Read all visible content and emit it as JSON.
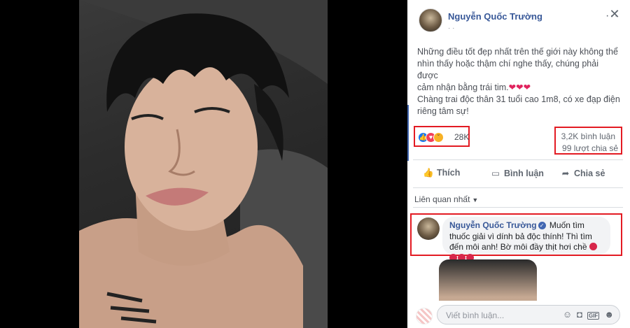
{
  "post": {
    "author": "Nguyễn Quốc Trường",
    "subtitle": "· ·",
    "more_label": "···",
    "close_label": "✕",
    "text_lines": [
      "Những điều tốt đẹp nhất trên thế giới này không thể",
      "nhìn thấy hoặc thậm chí nghe thấy, chúng phải được",
      "cảm nhận bằng trái tim.",
      "Chàng trai độc thân 31 tuổi cao 1m8, có xe đạp điện",
      "riêng tâm sự!"
    ],
    "hearts": "❤❤❤"
  },
  "stats": {
    "reactions_count": "28K",
    "reaction_icons": [
      "like-icon",
      "love-icon",
      "haha-icon"
    ],
    "comments": "3,2K bình luận",
    "shares": "99 lượt chia sẻ"
  },
  "actions": {
    "like": "Thích",
    "comment": "Bình luận",
    "share": "Chia sẻ"
  },
  "comments_section": {
    "sort_label": "Liên quan nhất",
    "top_comment": {
      "author": "Nguyễn Quốc Trường",
      "text_part1": "Muốn tìm thuốc giải vì dính bả độc thính! Thì tìm đến môi anh! Bờ môi đầy thịt hơi chề"
    },
    "write_placeholder": "Viết bình luận..."
  },
  "colors": {
    "brand_blue": "#385898",
    "highlight_red": "#e31b23"
  }
}
